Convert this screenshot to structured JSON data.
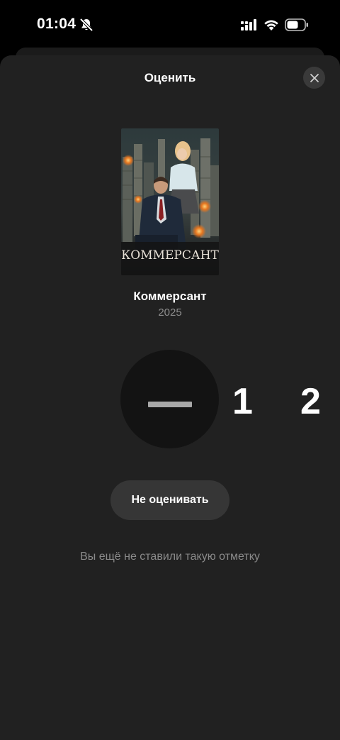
{
  "status_bar": {
    "time": "01:04",
    "icons": [
      "bell-muted-icon",
      "cellular-signal-icon",
      "wifi-icon",
      "battery-icon"
    ]
  },
  "sheet": {
    "title": "Оценить",
    "close_icon": "close-icon"
  },
  "movie": {
    "poster_title": "КОММЕРСАНТ",
    "title": "Коммерсант",
    "year": "2025"
  },
  "rating": {
    "current": "—",
    "options": [
      "1",
      "2"
    ]
  },
  "actions": {
    "skip_label": "Не оценивать"
  },
  "hint": "Вы ещё не ставили такую отметку",
  "colors": {
    "background": "#000000",
    "sheet": "#212121",
    "button": "#363636",
    "muted_text": "#8a8a8a"
  }
}
